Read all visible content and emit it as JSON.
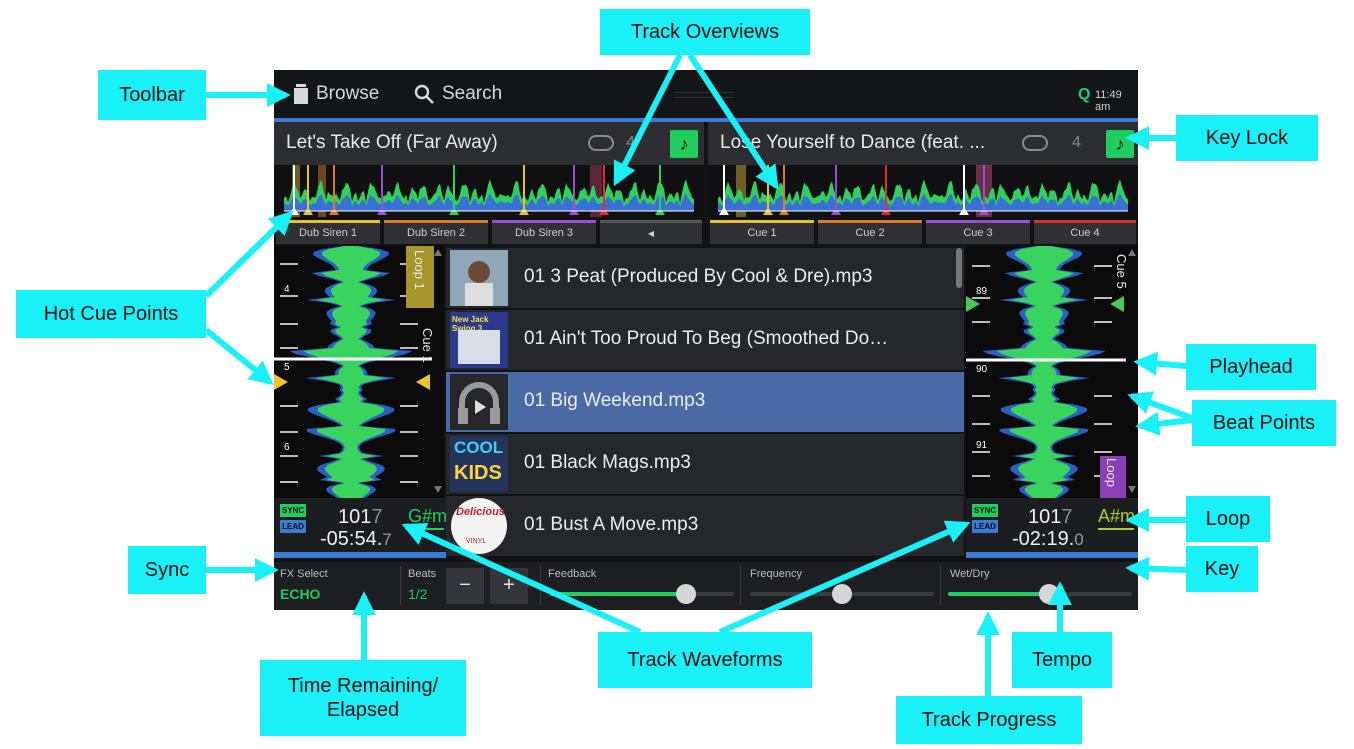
{
  "toolbar": {
    "browse_label": "Browse",
    "search_label": "Search",
    "quantize": "Q",
    "clock": "11:49 am"
  },
  "deck_left": {
    "title": "Let's Take Off (Far Away)",
    "loop_count": "4",
    "keylock_icon": "music-note-icon",
    "cues": [
      {
        "label": "Dub Siren 1",
        "color": "#e8c22c"
      },
      {
        "label": "Dub Siren 2",
        "color": "#e07a2a"
      },
      {
        "label": "Dub Siren 3",
        "color": "#9b4fd0"
      },
      {
        "label": "◀",
        "color": "#555555"
      }
    ],
    "waveform_side_label": "Cue 1",
    "loop_label": "Loop 1",
    "beat_numbers": [
      "4",
      "5",
      "6"
    ],
    "sync_badge": "SYNC",
    "lead_badge": "LEAD",
    "bpm_main": "101",
    "bpm_dim": "7",
    "key": "G#m",
    "time_main": "-05:54.",
    "time_dim": "7"
  },
  "deck_right": {
    "title": "Lose Yourself to Dance (feat. ...",
    "loop_count": "4",
    "keylock_icon": "music-note-icon",
    "cues": [
      {
        "label": "Cue 1",
        "color": "#e8c22c"
      },
      {
        "label": "Cue 2",
        "color": "#e07a2a"
      },
      {
        "label": "Cue 3",
        "color": "#9b4fd0"
      },
      {
        "label": "Cue 4",
        "color": "#d93030"
      }
    ],
    "waveform_side_label": "Cue 5",
    "loop_label": "Loop",
    "beat_numbers": [
      "89",
      "90",
      "91"
    ],
    "sync_badge": "SYNC",
    "lead_badge": "LEAD",
    "bpm_main": "101",
    "bpm_dim": "7",
    "key": "A#m",
    "time_main": "-02:19.",
    "time_dim": "0"
  },
  "library": [
    {
      "name": "01 3 Peat (Produced By Cool & Dre).mp3",
      "selected": false
    },
    {
      "name": "01 Ain't Too Proud To Beg (Smoothed Do…",
      "selected": false
    },
    {
      "name": "01 Big Weekend.mp3",
      "selected": true
    },
    {
      "name": "01 Black Mags.mp3",
      "selected": false
    },
    {
      "name": "01 Bust A Move.mp3",
      "selected": false
    }
  ],
  "album_art_text": {
    "row1": "New Jack Swing 3",
    "row3_1": "COOL",
    "row3_2": "KIDS",
    "row4": "Delicious",
    "row4_sub": "VINYL"
  },
  "fx": {
    "select_label": "FX Select",
    "select_value": "ECHO",
    "beats_label": "Beats",
    "beats_value": "1/2",
    "minus": "−",
    "plus": "+",
    "params": [
      {
        "label": "Feedback",
        "value": 0.74
      },
      {
        "label": "Frequency",
        "value": 0.5
      },
      {
        "label": "Wet/Dry",
        "value": 0.55
      }
    ]
  },
  "callouts": {
    "toolbar": "Toolbar",
    "track_overviews": "Track Overviews",
    "key_lock": "Key Lock",
    "hot_cue_points": "Hot Cue Points",
    "playhead": "Playhead",
    "beat_points": "Beat Points",
    "loop": "Loop",
    "key": "Key",
    "sync": "Sync",
    "time_remaining_1": "Time Remaining/",
    "time_remaining_2": "Elapsed",
    "track_waveforms": "Track Waveforms",
    "tempo": "Tempo",
    "track_progress": "Track Progress"
  },
  "colors": {
    "accent_green": "#1ecf5f",
    "accent_blue": "#3a7bd5",
    "callout": "#19f0f8",
    "selected_row": "#4a6aa5"
  }
}
